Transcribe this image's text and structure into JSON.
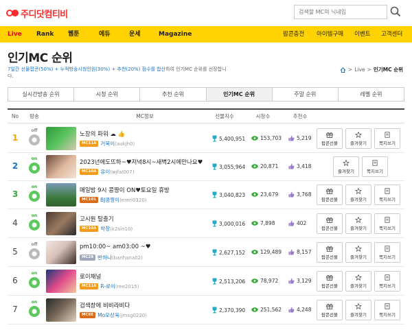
{
  "header": {
    "logo_text": "주디닷컴티비",
    "search_placeholder": "검색할 MC의 닉네임"
  },
  "nav": {
    "items": [
      {
        "label": "Live",
        "active": true
      },
      {
        "label": "Rank"
      },
      {
        "label": "웹툰"
      },
      {
        "label": "에듀"
      },
      {
        "label": "운세"
      },
      {
        "label": "Magazine"
      }
    ],
    "right_items": [
      "팝콘충전",
      "아이템구매",
      "이벤트",
      "고객센터"
    ]
  },
  "page": {
    "title": "인기MC 순위",
    "desc_hl1": "7일간 선물팝콘(50%) + 누적방송시청인원(30%) + 추천(20%) 점수를 합산",
    "desc_rest": "하여 인기MC 순위를 선정합니다.",
    "crumb_live": "Live",
    "crumb_current": "인기MC 순위"
  },
  "tabs": [
    "실시간방송 순위",
    "시청 순위",
    "추천 순위",
    "인기MC 순위",
    "주말 순위",
    "레벨 순위"
  ],
  "table_headers": {
    "no": "No",
    "onair": "방송",
    "info": "MC정보",
    "gift": "선물지수",
    "views": "시청수",
    "recommend": "추천수"
  },
  "buttons": {
    "gift": "팝콘선물",
    "fav": "즐겨찾기",
    "msg": "쪽지쓰기"
  },
  "rows": [
    {
      "rank": "1",
      "status": "off",
      "title": "노장의 파워 ☁ 👍",
      "badge": "MC11A",
      "name": "거북이",
      "id": "(aukjh0)",
      "gift": "5,400,951",
      "views": "153,703",
      "rec": "5,219"
    },
    {
      "rank": "2",
      "status": "on",
      "title": "2023년에도뜨하~♥저녁8시~새벽2시에만나요♥",
      "badge": "MC10A",
      "name": "유이",
      "id": "(wjfal007)",
      "gift": "3,055,964",
      "views": "20,871",
      "rec": "3,418"
    },
    {
      "rank": "3",
      "status": "on",
      "title": "매일밤 9시 콩짱이 ON♥토요일 휴방",
      "badge": "MC101",
      "name": "BJ콩짱이",
      "id": "(ereri0320)",
      "gift": "3,040,823",
      "views": "23,679",
      "rec": "3,768"
    },
    {
      "rank": "4",
      "status": "on",
      "title": "고시원 탈출기",
      "badge": "MC10A",
      "name": "박창",
      "id": "(k2sin10)",
      "gift": "3,000,016",
      "views": "7,898",
      "rec": "402"
    },
    {
      "rank": "5",
      "status": "off",
      "title": "pm10:00~ am03:00 ~♥",
      "badge": "MC29",
      "name": "반하나",
      "id": "(banhana02)",
      "gift": "2,627,152",
      "views": "129,489",
      "rec": "8,157"
    },
    {
      "rank": "6",
      "status": "on",
      "title": "로이채널",
      "badge": "MC11A",
      "name": "R-로이",
      "id": "(ree2015)",
      "gift": "2,513,206",
      "views": "78,972",
      "rec": "3,129"
    },
    {
      "rank": "7",
      "status": "on",
      "title": "검색창에 비비라비다",
      "badge": "MC6E",
      "name": "Mo모상욱",
      "id": "(jmsg0220)",
      "gift": "2,370,390",
      "views": "251,562",
      "rec": "4,248"
    }
  ],
  "colors": {
    "nav_bg": "#ffd200",
    "accent_red": "#e60012",
    "link_blue": "#1a73c9",
    "onair_green": "#3aa83a"
  }
}
